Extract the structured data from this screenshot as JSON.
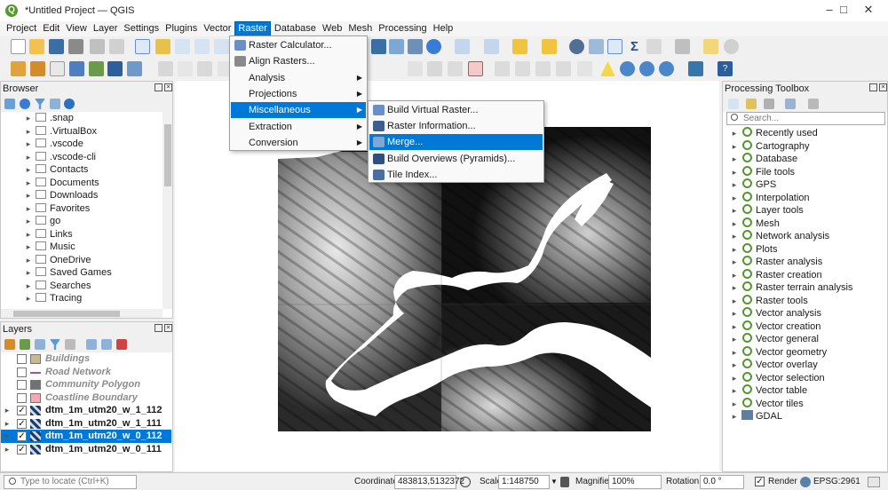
{
  "window": {
    "title": "*Untitled Project — QGIS",
    "logo": "Q"
  },
  "menubar": [
    "Project",
    "Edit",
    "View",
    "Layer",
    "Settings",
    "Plugins",
    "Vector",
    "Raster",
    "Database",
    "Web",
    "Mesh",
    "Processing",
    "Help"
  ],
  "raster_menu": {
    "items": [
      {
        "label": "Raster Calculator...",
        "submenu": false
      },
      {
        "label": "Align Rasters...",
        "submenu": false
      },
      {
        "label": "Analysis",
        "submenu": true
      },
      {
        "label": "Projections",
        "submenu": true
      },
      {
        "label": "Miscellaneous",
        "submenu": true
      },
      {
        "label": "Extraction",
        "submenu": true
      },
      {
        "label": "Conversion",
        "submenu": true
      }
    ]
  },
  "misc_submenu": {
    "items": [
      "Build Virtual Raster...",
      "Raster Information...",
      "Merge...",
      "Build Overviews (Pyramids)...",
      "Tile Index..."
    ]
  },
  "browser": {
    "title": "Browser",
    "items": [
      ".snap",
      ".VirtualBox",
      ".vscode",
      ".vscode-cli",
      "Contacts",
      "Documents",
      "Downloads",
      "Favorites",
      "go",
      "Links",
      "Music",
      "OneDrive",
      "Saved Games",
      "Searches",
      "Tracing"
    ]
  },
  "layers": {
    "title": "Layers",
    "items": [
      {
        "name": "Buildings",
        "checked": false,
        "visible_style": "ghost",
        "symbol": "#c8b896"
      },
      {
        "name": "Road Network",
        "checked": false,
        "visible_style": "ghost",
        "symbol": "#8e5aa8"
      },
      {
        "name": "Community Polygon",
        "checked": false,
        "visible_style": "ghost",
        "symbol": "#6e7378"
      },
      {
        "name": "Coastline Boundary",
        "checked": false,
        "visible_style": "ghost",
        "symbol": "#f4a7b4"
      },
      {
        "name": "dtm_1m_utm20_w_1_112",
        "checked": true,
        "visible_style": "normal",
        "symbol": "raster"
      },
      {
        "name": "dtm_1m_utm20_w_1_111",
        "checked": true,
        "visible_style": "normal",
        "symbol": "raster"
      },
      {
        "name": "dtm_1m_utm20_w_0_112",
        "checked": true,
        "visible_style": "selected",
        "symbol": "raster"
      },
      {
        "name": "dtm_1m_utm20_w_0_111",
        "checked": true,
        "visible_style": "normal",
        "symbol": "raster"
      }
    ]
  },
  "toolbox": {
    "title": "Processing Toolbox",
    "search_placeholder": "Search...",
    "items": [
      "Recently used",
      "Cartography",
      "Database",
      "File tools",
      "GPS",
      "Interpolation",
      "Layer tools",
      "Mesh",
      "Network analysis",
      "Plots",
      "Raster analysis",
      "Raster creation",
      "Raster terrain analysis",
      "Raster tools",
      "Vector analysis",
      "Vector creation",
      "Vector general",
      "Vector geometry",
      "Vector overlay",
      "Vector selection",
      "Vector table",
      "Vector tiles",
      "GDAL"
    ]
  },
  "statusbar": {
    "locate_placeholder": "Type to locate (Ctrl+K)",
    "coordinate_label": "Coordinate",
    "coordinate_value": "483813,5132372",
    "scale_label": "Scale",
    "scale_value": "1:148750",
    "magnifier_label": "Magnifier",
    "magnifier_value": "100%",
    "rotation_label": "Rotation",
    "rotation_value": "0.0 °",
    "render_label": "Render",
    "crs_label": "EPSG:2961"
  },
  "colors": {
    "accent": "#0078d7",
    "qgis_green": "#589632",
    "map_land_dark": "#000000"
  }
}
